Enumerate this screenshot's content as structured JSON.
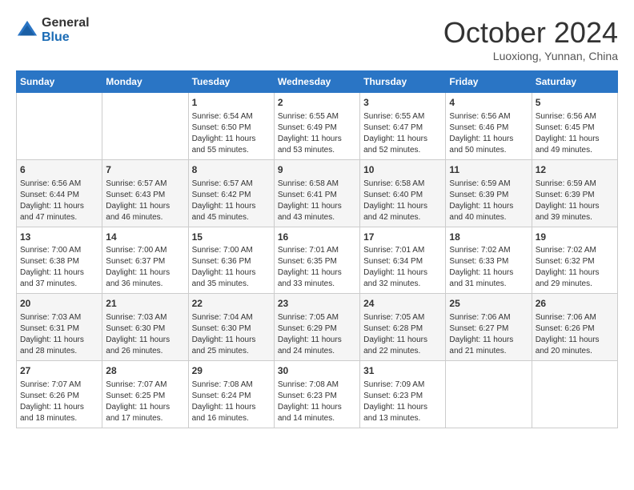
{
  "header": {
    "logo_general": "General",
    "logo_blue": "Blue",
    "month_title": "October 2024",
    "subtitle": "Luoxiong, Yunnan, China"
  },
  "weekdays": [
    "Sunday",
    "Monday",
    "Tuesday",
    "Wednesday",
    "Thursday",
    "Friday",
    "Saturday"
  ],
  "weeks": [
    [
      {
        "day": "",
        "sunrise": "",
        "sunset": "",
        "daylight": ""
      },
      {
        "day": "",
        "sunrise": "",
        "sunset": "",
        "daylight": ""
      },
      {
        "day": "1",
        "sunrise": "Sunrise: 6:54 AM",
        "sunset": "Sunset: 6:50 PM",
        "daylight": "Daylight: 11 hours and 55 minutes."
      },
      {
        "day": "2",
        "sunrise": "Sunrise: 6:55 AM",
        "sunset": "Sunset: 6:49 PM",
        "daylight": "Daylight: 11 hours and 53 minutes."
      },
      {
        "day": "3",
        "sunrise": "Sunrise: 6:55 AM",
        "sunset": "Sunset: 6:47 PM",
        "daylight": "Daylight: 11 hours and 52 minutes."
      },
      {
        "day": "4",
        "sunrise": "Sunrise: 6:56 AM",
        "sunset": "Sunset: 6:46 PM",
        "daylight": "Daylight: 11 hours and 50 minutes."
      },
      {
        "day": "5",
        "sunrise": "Sunrise: 6:56 AM",
        "sunset": "Sunset: 6:45 PM",
        "daylight": "Daylight: 11 hours and 49 minutes."
      }
    ],
    [
      {
        "day": "6",
        "sunrise": "Sunrise: 6:56 AM",
        "sunset": "Sunset: 6:44 PM",
        "daylight": "Daylight: 11 hours and 47 minutes."
      },
      {
        "day": "7",
        "sunrise": "Sunrise: 6:57 AM",
        "sunset": "Sunset: 6:43 PM",
        "daylight": "Daylight: 11 hours and 46 minutes."
      },
      {
        "day": "8",
        "sunrise": "Sunrise: 6:57 AM",
        "sunset": "Sunset: 6:42 PM",
        "daylight": "Daylight: 11 hours and 45 minutes."
      },
      {
        "day": "9",
        "sunrise": "Sunrise: 6:58 AM",
        "sunset": "Sunset: 6:41 PM",
        "daylight": "Daylight: 11 hours and 43 minutes."
      },
      {
        "day": "10",
        "sunrise": "Sunrise: 6:58 AM",
        "sunset": "Sunset: 6:40 PM",
        "daylight": "Daylight: 11 hours and 42 minutes."
      },
      {
        "day": "11",
        "sunrise": "Sunrise: 6:59 AM",
        "sunset": "Sunset: 6:39 PM",
        "daylight": "Daylight: 11 hours and 40 minutes."
      },
      {
        "day": "12",
        "sunrise": "Sunrise: 6:59 AM",
        "sunset": "Sunset: 6:39 PM",
        "daylight": "Daylight: 11 hours and 39 minutes."
      }
    ],
    [
      {
        "day": "13",
        "sunrise": "Sunrise: 7:00 AM",
        "sunset": "Sunset: 6:38 PM",
        "daylight": "Daylight: 11 hours and 37 minutes."
      },
      {
        "day": "14",
        "sunrise": "Sunrise: 7:00 AM",
        "sunset": "Sunset: 6:37 PM",
        "daylight": "Daylight: 11 hours and 36 minutes."
      },
      {
        "day": "15",
        "sunrise": "Sunrise: 7:00 AM",
        "sunset": "Sunset: 6:36 PM",
        "daylight": "Daylight: 11 hours and 35 minutes."
      },
      {
        "day": "16",
        "sunrise": "Sunrise: 7:01 AM",
        "sunset": "Sunset: 6:35 PM",
        "daylight": "Daylight: 11 hours and 33 minutes."
      },
      {
        "day": "17",
        "sunrise": "Sunrise: 7:01 AM",
        "sunset": "Sunset: 6:34 PM",
        "daylight": "Daylight: 11 hours and 32 minutes."
      },
      {
        "day": "18",
        "sunrise": "Sunrise: 7:02 AM",
        "sunset": "Sunset: 6:33 PM",
        "daylight": "Daylight: 11 hours and 31 minutes."
      },
      {
        "day": "19",
        "sunrise": "Sunrise: 7:02 AM",
        "sunset": "Sunset: 6:32 PM",
        "daylight": "Daylight: 11 hours and 29 minutes."
      }
    ],
    [
      {
        "day": "20",
        "sunrise": "Sunrise: 7:03 AM",
        "sunset": "Sunset: 6:31 PM",
        "daylight": "Daylight: 11 hours and 28 minutes."
      },
      {
        "day": "21",
        "sunrise": "Sunrise: 7:03 AM",
        "sunset": "Sunset: 6:30 PM",
        "daylight": "Daylight: 11 hours and 26 minutes."
      },
      {
        "day": "22",
        "sunrise": "Sunrise: 7:04 AM",
        "sunset": "Sunset: 6:30 PM",
        "daylight": "Daylight: 11 hours and 25 minutes."
      },
      {
        "day": "23",
        "sunrise": "Sunrise: 7:05 AM",
        "sunset": "Sunset: 6:29 PM",
        "daylight": "Daylight: 11 hours and 24 minutes."
      },
      {
        "day": "24",
        "sunrise": "Sunrise: 7:05 AM",
        "sunset": "Sunset: 6:28 PM",
        "daylight": "Daylight: 11 hours and 22 minutes."
      },
      {
        "day": "25",
        "sunrise": "Sunrise: 7:06 AM",
        "sunset": "Sunset: 6:27 PM",
        "daylight": "Daylight: 11 hours and 21 minutes."
      },
      {
        "day": "26",
        "sunrise": "Sunrise: 7:06 AM",
        "sunset": "Sunset: 6:26 PM",
        "daylight": "Daylight: 11 hours and 20 minutes."
      }
    ],
    [
      {
        "day": "27",
        "sunrise": "Sunrise: 7:07 AM",
        "sunset": "Sunset: 6:26 PM",
        "daylight": "Daylight: 11 hours and 18 minutes."
      },
      {
        "day": "28",
        "sunrise": "Sunrise: 7:07 AM",
        "sunset": "Sunset: 6:25 PM",
        "daylight": "Daylight: 11 hours and 17 minutes."
      },
      {
        "day": "29",
        "sunrise": "Sunrise: 7:08 AM",
        "sunset": "Sunset: 6:24 PM",
        "daylight": "Daylight: 11 hours and 16 minutes."
      },
      {
        "day": "30",
        "sunrise": "Sunrise: 7:08 AM",
        "sunset": "Sunset: 6:23 PM",
        "daylight": "Daylight: 11 hours and 14 minutes."
      },
      {
        "day": "31",
        "sunrise": "Sunrise: 7:09 AM",
        "sunset": "Sunset: 6:23 PM",
        "daylight": "Daylight: 11 hours and 13 minutes."
      },
      {
        "day": "",
        "sunrise": "",
        "sunset": "",
        "daylight": ""
      },
      {
        "day": "",
        "sunrise": "",
        "sunset": "",
        "daylight": ""
      }
    ]
  ]
}
